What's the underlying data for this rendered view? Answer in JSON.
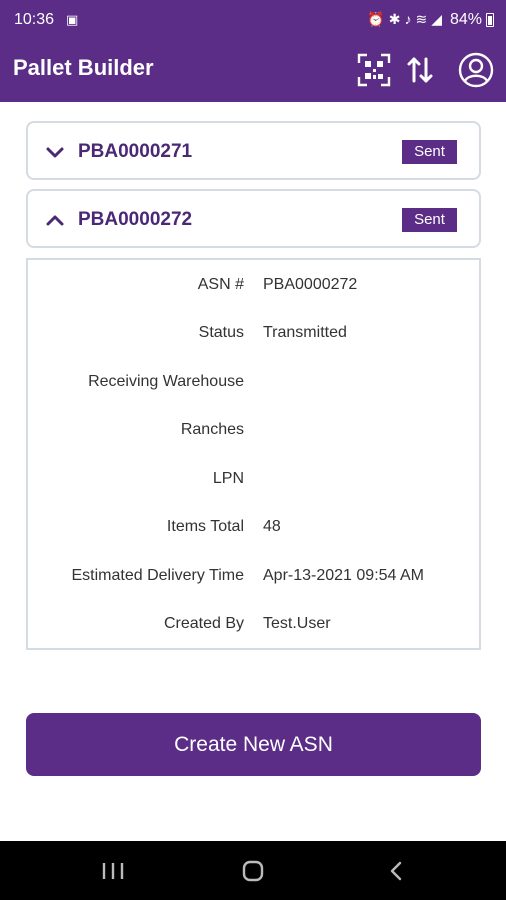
{
  "status_bar": {
    "time": "10:36",
    "left_icon": "screenshot-icon",
    "icons": [
      "alarm-icon",
      "bluetooth-icon",
      "mute-icon",
      "wifi-icon",
      "signal-icon"
    ],
    "battery_percent": "84%"
  },
  "app_bar": {
    "title": "Pallet Builder",
    "actions": [
      "qr-scan-icon",
      "sort-arrows-icon",
      "user-profile-icon"
    ]
  },
  "asn_list": [
    {
      "id": "PBA0000271",
      "status_badge": "Sent",
      "expanded": false
    },
    {
      "id": "PBA0000272",
      "status_badge": "Sent",
      "expanded": true
    }
  ],
  "details": {
    "asn_number": {
      "label": "ASN #",
      "value": "PBA0000272"
    },
    "status": {
      "label": "Status",
      "value": "Transmitted"
    },
    "receiving_warehouse": {
      "label": "Receiving Warehouse",
      "value": ""
    },
    "ranches": {
      "label": "Ranches",
      "value": ""
    },
    "lpn": {
      "label": "LPN",
      "value": ""
    },
    "items_total": {
      "label": "Items Total",
      "value": "48"
    },
    "estimated_delivery": {
      "label": "Estimated Delivery Time",
      "value": "Apr-13-2021 09:54 AM"
    },
    "created_by": {
      "label": "Created By",
      "value": "Test.User"
    }
  },
  "create_button": {
    "label": "Create New ASN"
  },
  "nav_bar": {
    "buttons": [
      "recents-icon",
      "home-icon",
      "back-icon"
    ]
  },
  "colors": {
    "primary": "#5b2d86",
    "text_dark": "#333333",
    "border": "#d5dbe2"
  }
}
